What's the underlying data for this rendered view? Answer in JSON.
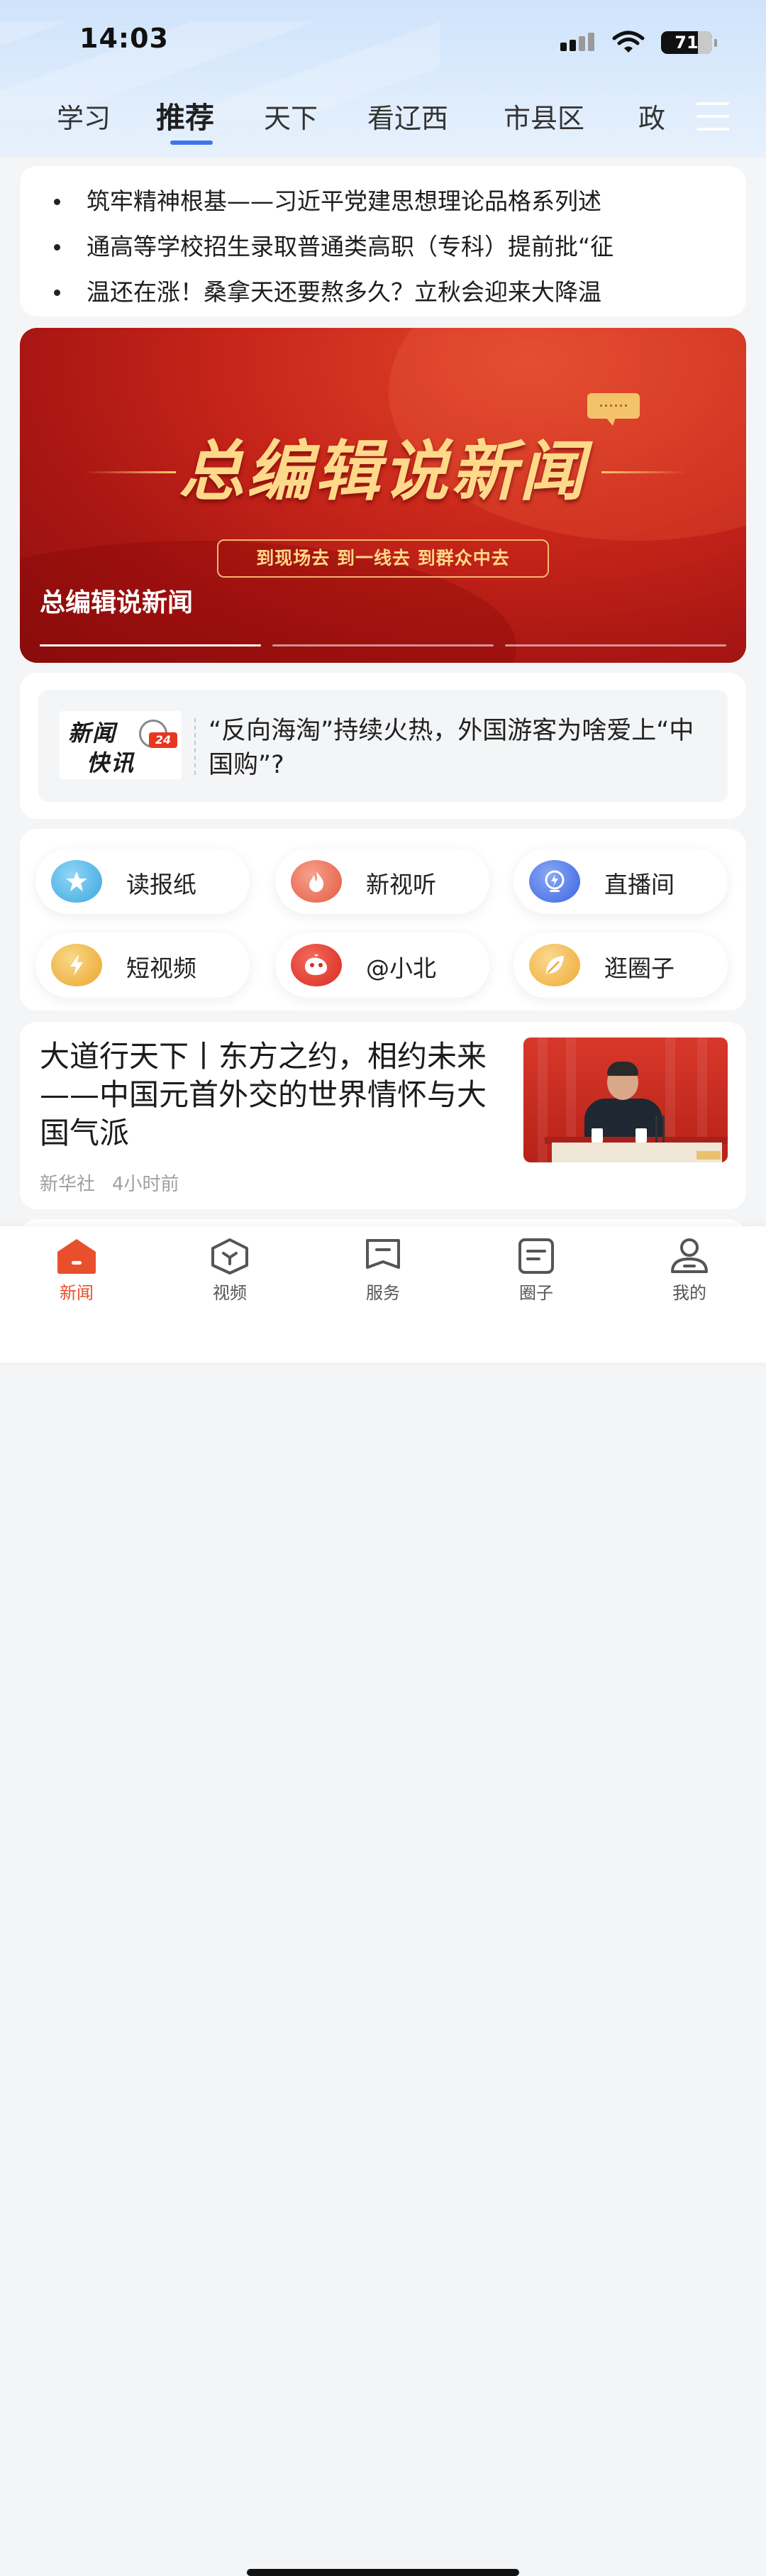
{
  "status_bar": {
    "time": "14:03",
    "battery": "71"
  },
  "channels": {
    "tabs": [
      "学习",
      "推荐",
      "天下",
      "看辽西",
      "市县区",
      "政"
    ],
    "active_index": 1
  },
  "headlines": [
    "筑牢精神根基——习近平党建思想理论品格系列述",
    "通高等学校招生录取普通类高职（专科）提前批“征",
    "温还在涨！桑拿天还要熬多久？立秋会迎来大降温"
  ],
  "banner": {
    "title": "总编辑说新闻",
    "bubble": "......",
    "slogan": "到现场去  到一线去  到群众中去",
    "caption": "总编辑说新闻"
  },
  "news_flash": {
    "logo_line1": "新闻",
    "logo_line2": "快讯",
    "logo_badge": "24",
    "text": "“反向海淘”持续火热，外国游客为啥爱上“中国购”?"
  },
  "shortcuts": [
    {
      "label": "读报纸",
      "icon": "star-icon",
      "color": "#4fb8ea"
    },
    {
      "label": "新视听",
      "icon": "flame-icon",
      "color": "#ee6a50"
    },
    {
      "label": "直播间",
      "icon": "live-icon",
      "color": "#4a7ae8"
    },
    {
      "label": "短视频",
      "icon": "lightning-icon",
      "color": "#f2b53a"
    },
    {
      "label": "@小北",
      "icon": "whale-icon",
      "color": "#e8342a"
    },
    {
      "label": "逛圈子",
      "icon": "leaf-icon",
      "color": "#f0bb3c"
    }
  ],
  "article": {
    "title": "大道行天下丨东方之约，相约未来——中国元首外交的世界情怀与大国气派",
    "source": "新华社",
    "time": "4小时前"
  },
  "tab_bar": {
    "items": [
      "新闻",
      "视频",
      "服务",
      "圈子",
      "我的"
    ],
    "active_index": 0,
    "active_color": "#e8502c"
  }
}
